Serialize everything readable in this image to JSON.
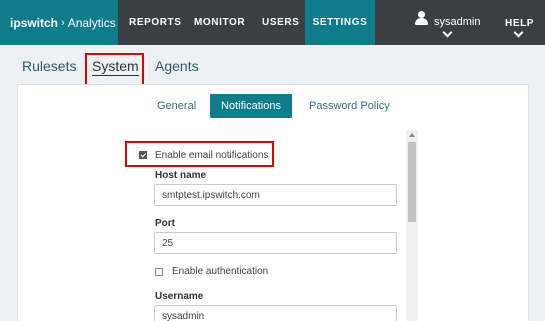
{
  "topbar": {
    "brand_name": "ipswitch",
    "brand_sep": "›",
    "brand_product": "Analytics",
    "nav": [
      {
        "label": "REPORTS"
      },
      {
        "label": "MONITOR"
      },
      {
        "label": "USERS"
      },
      {
        "label": "SETTINGS",
        "active": true
      }
    ],
    "username": "sysadmin",
    "help_label": "HELP"
  },
  "subtabs": [
    {
      "label": "Rulesets"
    },
    {
      "label": "System",
      "active": true
    },
    {
      "label": "Agents"
    }
  ],
  "panel_tabs": [
    {
      "label": "General"
    },
    {
      "label": "Notifications",
      "active": true
    },
    {
      "label": "Password Policy"
    }
  ],
  "form": {
    "enable_email_label": "Enable email notifications",
    "enable_email_checked": true,
    "host_label": "Host name",
    "host_value": "smtptest.ipswitch.com",
    "port_label": "Port",
    "port_value": "25",
    "enable_auth_label": "Enable authentication",
    "enable_auth_checked": false,
    "username_label": "Username",
    "username_value": "sysadmin"
  },
  "colors": {
    "accent": "#0f7c8c",
    "topbar": "#3a3f44",
    "highlight": "#e00000"
  }
}
